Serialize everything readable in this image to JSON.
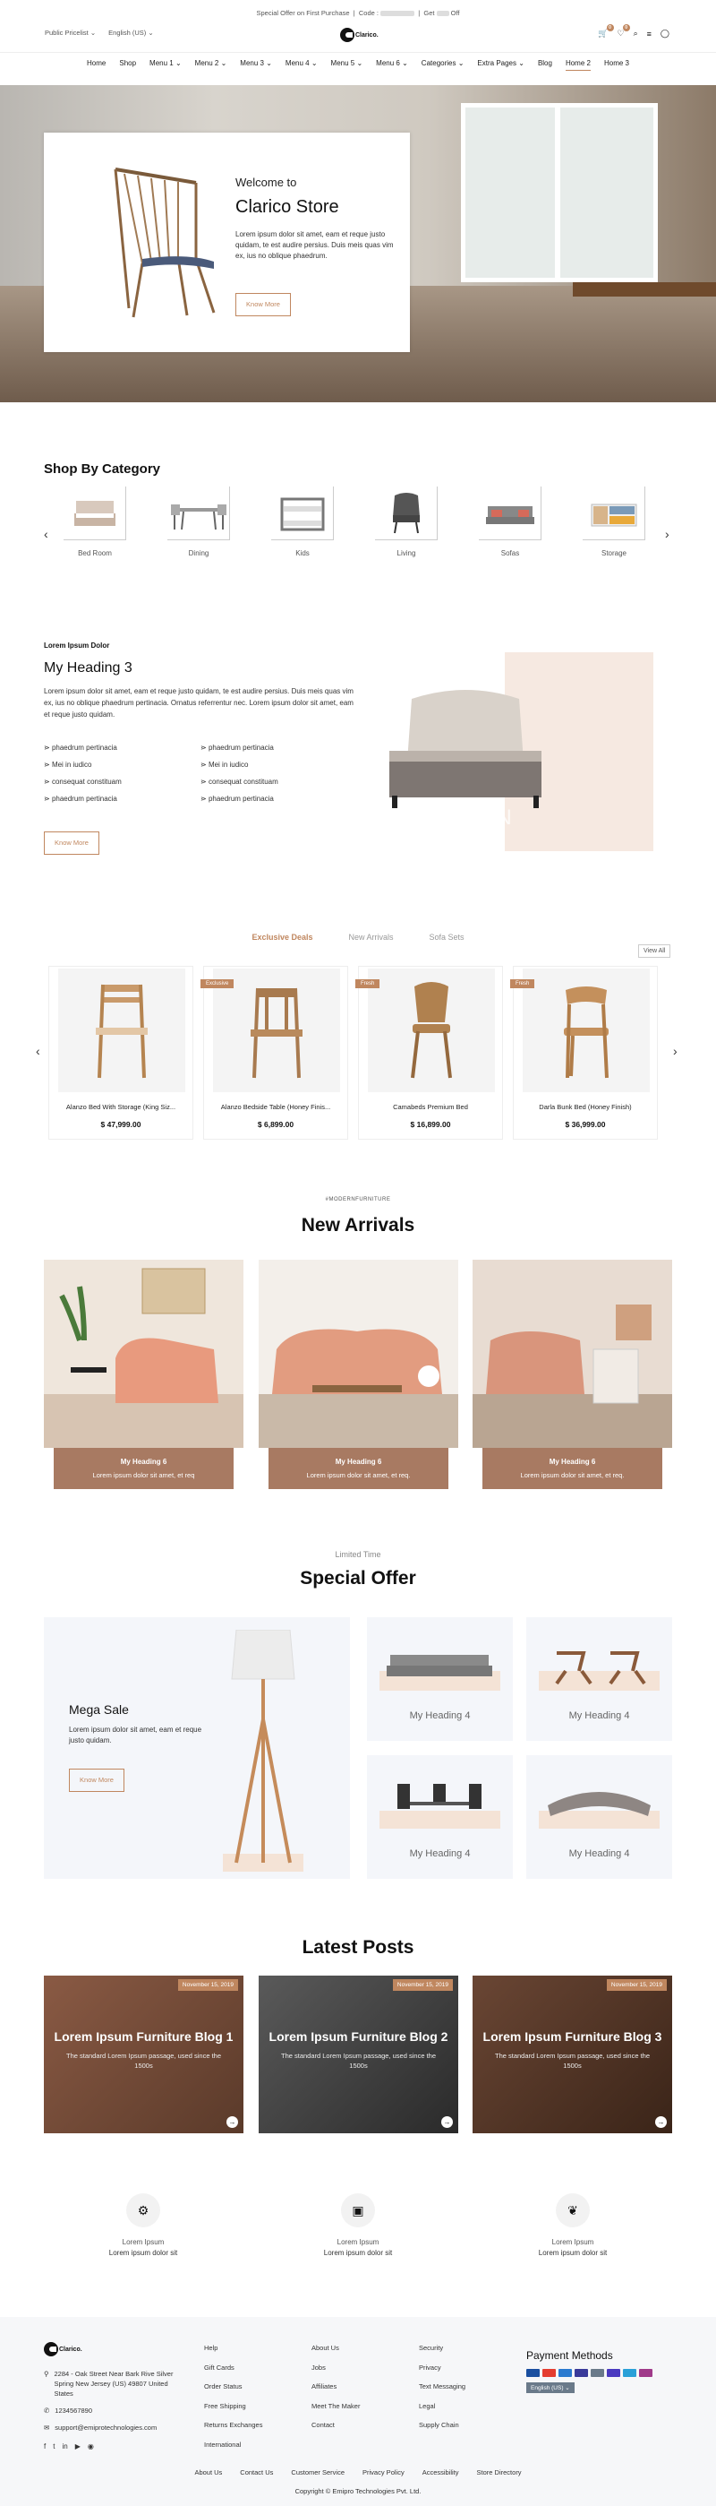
{
  "topbar": {
    "offer": "Special Offer on First Purchase",
    "code": "Code :",
    "get": "Get",
    "off": "Off"
  },
  "header": {
    "pricelist": "Public Pricelist",
    "lang": "English (US)",
    "cart_count": "0",
    "wish_count": "0",
    "logo": "Clarico."
  },
  "nav": [
    "Home",
    "Shop",
    "Menu 1",
    "Menu 2",
    "Menu 3",
    "Menu 4",
    "Menu 5",
    "Menu 6",
    "Categories",
    "Extra Pages",
    "Blog",
    "Home 2",
    "Home 3"
  ],
  "hero": {
    "welcome": "Welcome to",
    "title": "Clarico Store",
    "desc": "Lorem ipsum dolor sit amet, eam et reque justo quidam, te est audire persius. Duis meis quas vim ex, ius no oblique phaedrum.",
    "button": "Know More"
  },
  "categories": {
    "title": "Shop By Category",
    "items": [
      "Bed Room",
      "Dining",
      "Kids",
      "Living",
      "Sofas",
      "Storage"
    ]
  },
  "feature": {
    "small": "Lorem Ipsum Dolor",
    "heading": "My Heading 3",
    "para": "Lorem ipsum dolor sit amet, eam et reque justo quidam, te est audire persius. Duis meis quas vim ex, ius no oblique phaedrum pertinacia. Ornatus referrentur nec. Lorem ipsum dolor sit amet, eam et reque justo quidam.",
    "bullets": [
      "phaedrum pertinacia",
      "phaedrum pertinacia",
      "Mei in iudico",
      "Mei in iudico",
      "consequat constituam",
      "consequat constituam",
      "phaedrum pertinacia",
      "phaedrum pertinacia"
    ],
    "button": "Know More",
    "image_text": "MODERN"
  },
  "deals": {
    "tabs": [
      "Exclusive Deals",
      "New Arrivals",
      "Sofa Sets"
    ],
    "view_all": "View All",
    "products": [
      {
        "name": "Alanzo Bed With Storage (King Siz...",
        "price": "$ 47,999.00",
        "tag": ""
      },
      {
        "name": "Alanzo Bedside Table (Honey Finis...",
        "price": "$ 6,899.00",
        "tag": "Exclusive"
      },
      {
        "name": "Camabeds Premium Bed",
        "price": "$ 16,899.00",
        "tag": "Fresh"
      },
      {
        "name": "Darla Bunk Bed (Honey Finish)",
        "price": "$ 36,999.00",
        "tag": "Fresh"
      }
    ]
  },
  "new_arrivals": {
    "hashtag": "#MODERNFURNITURE",
    "title": "New Arrivals",
    "cards": [
      {
        "title": "My Heading 6",
        "desc": "Lorem ipsum dolor sit amet, et req"
      },
      {
        "title": "My Heading 6",
        "desc": "Lorem ipsum dolor sit amet, et req."
      },
      {
        "title": "My Heading 6",
        "desc": "Lorem ipsum dolor sit amet, et req."
      }
    ]
  },
  "special": {
    "small": "Limited Time",
    "title": "Special Offer",
    "mega_title": "Mega Sale",
    "mega_desc": "Lorem ipsum dolor sit amet, eam et reque justo quidam.",
    "button": "Know More",
    "boxes": [
      "My Heading 4",
      "My Heading 4",
      "My Heading 4",
      "My Heading 4"
    ]
  },
  "posts": {
    "title": "Latest Posts",
    "items": [
      {
        "date": "November 15, 2019",
        "title": "Lorem Ipsum Furniture Blog 1",
        "desc": "The standard Lorem Ipsum passage, used since the 1500s"
      },
      {
        "date": "November 15, 2019",
        "title": "Lorem Ipsum Furniture Blog 2",
        "desc": "The standard Lorem Ipsum passage, used since the 1500s"
      },
      {
        "date": "November 15, 2019",
        "title": "Lorem Ipsum Furniture Blog 3",
        "desc": "The standard Lorem Ipsum passage, used since the 1500s"
      }
    ]
  },
  "features": [
    {
      "a": "Lorem Ipsum",
      "b": "Lorem ipsum dolor sit"
    },
    {
      "a": "Lorem Ipsum",
      "b": "Lorem ipsum dolor sit"
    },
    {
      "a": "Lorem Ipsum",
      "b": "Lorem ipsum dolor sit"
    }
  ],
  "footer": {
    "logo": "Clarico.",
    "address": "2284 - Oak Street  Near Bark Rive Silver Spring  New Jersey (US)  49807 United States",
    "phone": "1234567890",
    "email": "support@emiprotechnologies.com",
    "col1": [
      "Help",
      "Gift Cards",
      "Order Status",
      "Free Shipping",
      "Returns Exchanges",
      "International"
    ],
    "col2": [
      "About Us",
      "Jobs",
      "Affiliates",
      "Meet The Maker",
      "Contact"
    ],
    "col3": [
      "Security",
      "Privacy",
      "Text Messaging",
      "Legal",
      "Supply Chain"
    ],
    "payment_title": "Payment Methods",
    "lang": "English (US)",
    "bottom_links": [
      "About Us",
      "Contact Us",
      "Customer Service",
      "Privacy Policy",
      "Accessibility",
      "Store Directory"
    ],
    "copyright": "Copyright © Emipro Technologies Pvt. Ltd."
  }
}
